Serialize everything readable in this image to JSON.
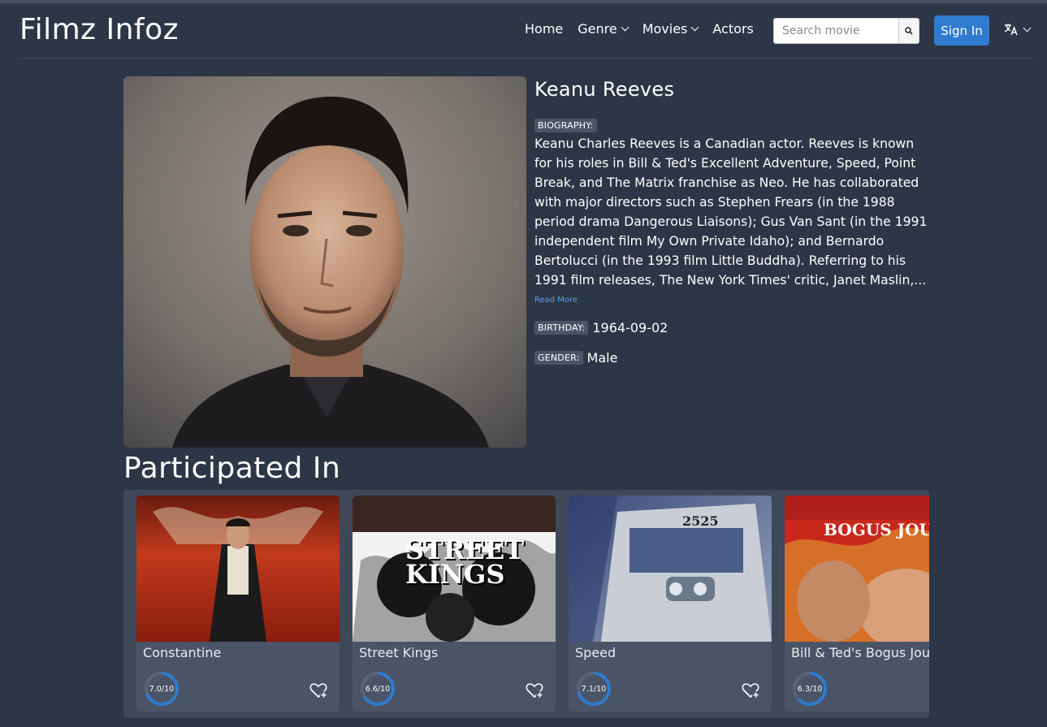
{
  "brand": "Filmz Infoz",
  "nav": {
    "home": "Home",
    "genre": "Genre",
    "movies": "Movies",
    "actors": "Actors",
    "search_placeholder": "Search movie",
    "sign_in": "Sign In",
    "language_icon": "translate-icon"
  },
  "actor": {
    "name": "Keanu Reeves",
    "biography_label": "BIOGRAPHY:",
    "biography": "Keanu Charles Reeves is a Canadian actor. Reeves is known for his roles in Bill & Ted's Excellent Adventure, Speed, Point Break, and The Matrix franchise as Neo. He has collaborated with major directors such as Stephen Frears (in the 1988 period drama Dangerous Liaisons); Gus Van Sant (in the 1991 independent film My Own Private Idaho); and Bernardo Bertolucci (in the 1993 film Little Buddha). Referring to his 1991 film releases, The New York Times' critic, Janet Maslin,...",
    "read_more": "Read More",
    "birthday_label": "BIRTHDAY:",
    "birthday": "1964-09-02",
    "gender_label": "GENDER:",
    "gender": "Male"
  },
  "participated": {
    "title": "Participated In",
    "movies": [
      {
        "title": "Constantine",
        "rating_text": "7.0/10",
        "rating": 7.0
      },
      {
        "title": "Street Kings",
        "rating_text": "6.6/10",
        "rating": 6.6,
        "poster_text": "STREET KINGS"
      },
      {
        "title": "Speed",
        "rating_text": "7.1/10",
        "rating": 7.1,
        "poster_text": "2525"
      },
      {
        "title": "Bill & Ted's Bogus Journey",
        "rating_text": "6.3/10",
        "rating": 6.3,
        "poster_text": "BOGUS JOURN"
      }
    ]
  },
  "colors": {
    "background": "#2c3646",
    "accent": "#2f7bd0",
    "rating_ring": "#2f7bd0",
    "link": "#5b9ee8"
  }
}
